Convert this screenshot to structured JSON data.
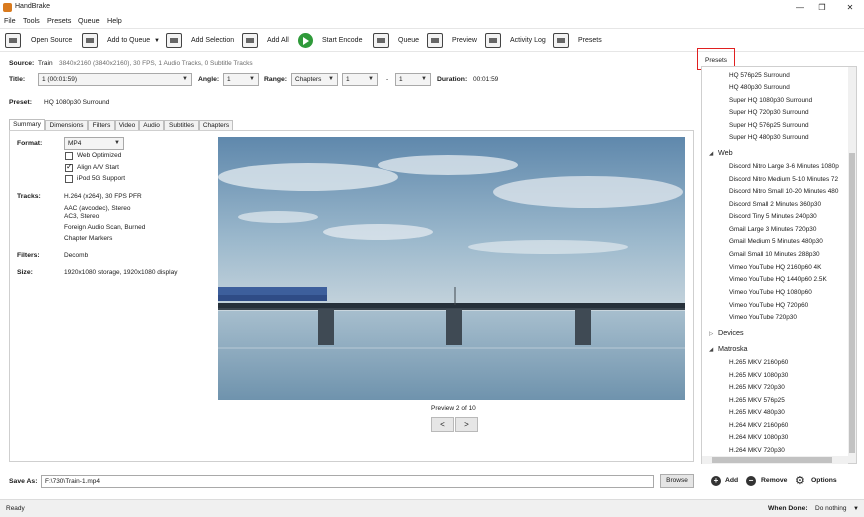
{
  "window": {
    "title": "HandBrake",
    "minimize": "—",
    "restore": "❐",
    "close": "✕"
  },
  "menu": [
    "File",
    "Tools",
    "Presets",
    "Queue",
    "Help"
  ],
  "toolbar": {
    "open_source": "Open Source",
    "add_to_queue": "Add to Queue",
    "add_selection": "Add Selection",
    "add_all": "Add All",
    "start_encode": "Start Encode",
    "queue": "Queue",
    "preview": "Preview",
    "activity_log": "Activity Log",
    "presets": "Presets"
  },
  "source": {
    "label": "Source:",
    "name": "Train",
    "details": "3840x2160 (3840x2160), 30 FPS, 1 Audio Tracks, 0 Subtitle Tracks"
  },
  "title_row": {
    "title_label": "Title:",
    "title_value": "1 (00:01:59)",
    "angle_label": "Angle:",
    "angle_value": "1",
    "range_label": "Range:",
    "range_type": "Chapters",
    "range_start": "1",
    "range_dash": "-",
    "range_end": "1",
    "duration_label": "Duration:",
    "duration_value": "00:01:59"
  },
  "preset": {
    "label": "Preset:",
    "value": "HQ 1080p30 Surround"
  },
  "tabs": [
    "Summary",
    "Dimensions",
    "Filters",
    "Video",
    "Audio",
    "Subtitles",
    "Chapters"
  ],
  "summary": {
    "format_label": "Format:",
    "format_value": "MP4",
    "web_optimized": "Web Optimized",
    "align_av": "Align A/V Start",
    "ipod": "iPod 5G Support",
    "tracks_label": "Tracks:",
    "tracks": [
      "H.264 (x264), 30 FPS PFR",
      "AAC (avcodec), Stereo",
      "AC3, Stereo",
      "Foreign Audio Scan, Burned",
      "Chapter Markers"
    ],
    "filters_label": "Filters:",
    "filters_value": "Decomb",
    "size_label": "Size:",
    "size_value": "1920x1080 storage, 1920x1080 display",
    "preview_caption": "Preview 2 of 10",
    "prev": "<",
    "next": ">"
  },
  "save_as": {
    "label": "Save As:",
    "path": "F:\\730\\Train-1.mp4",
    "browse": "Browse"
  },
  "status": {
    "text": "Ready",
    "when_done_label": "When Done:",
    "when_done_value": "Do nothing"
  },
  "presets_panel": {
    "tab_label": "Presets",
    "items_top": [
      "HQ 576p25 Surround",
      "HQ 480p30 Surround",
      "Super HQ 1080p30 Surround",
      "Super HQ 720p30 Surround",
      "Super HQ 576p25 Surround",
      "Super HQ 480p30 Surround"
    ],
    "cat_web": "Web",
    "web_items": [
      "Discord Nitro Large 3-6 Minutes 1080p",
      "Discord Nitro Medium 5-10 Minutes 72",
      "Discord Nitro Small 10-20 Minutes 480",
      "Discord Small 2 Minutes 360p30",
      "Discord Tiny 5 Minutes 240p30",
      "Gmail Large 3 Minutes 720p30",
      "Gmail Medium 5 Minutes 480p30",
      "Gmail Small 10 Minutes 288p30",
      "Vimeo YouTube HQ 2160p60 4K",
      "Vimeo YouTube HQ 1440p60 2.5K",
      "Vimeo YouTube HQ 1080p60",
      "Vimeo YouTube HQ 720p60",
      "Vimeo YouTube 720p30"
    ],
    "cat_devices": "Devices",
    "cat_matroska": "Matroska",
    "mkv_items": [
      "H.265 MKV 2160p60",
      "H.265 MKV 1080p30",
      "H.265 MKV 720p30",
      "H.265 MKV 576p25",
      "H.265 MKV 480p30",
      "H.264 MKV 2160p60",
      "H.264 MKV 1080p30",
      "H.264 MKV 720p30"
    ],
    "add": "Add",
    "remove": "Remove",
    "options": "Options"
  }
}
